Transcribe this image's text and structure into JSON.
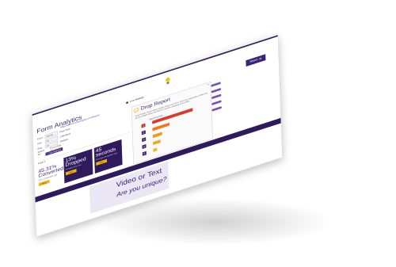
{
  "app": {
    "page_title": "Form Analytics",
    "url_text": "http://www.formanalytics.com/report",
    "hint_text": "Live Settings",
    "share_label": "Share"
  },
  "filters": {
    "rows": [
      {
        "label": "Form",
        "select": "Sign up",
        "value": "Free Trial"
      },
      {
        "label": "URL",
        "select": "All",
        "value": "Checkout"
      },
      {
        "label": "Seg",
        "select": "All",
        "value": "Visitors"
      }
    ],
    "add_segment_label": "+ Add Segment",
    "date_labels": {
      "from": "Select",
      "to": "From date"
    },
    "date_values": {
      "from": "All",
      "to": "26 - 4 - 15"
    }
  },
  "form_label": "Form 1",
  "kpis": {
    "conversion": {
      "value": "45.31%",
      "label": "Converted",
      "sub": "Form conversion rate",
      "button": "View"
    },
    "dropped": {
      "value": "13%",
      "label": "Dropped",
      "sub": "Average drop rate",
      "button": "View"
    },
    "time": {
      "value": "45",
      "label": "seconds",
      "sub": "Average completion time",
      "button": "View"
    }
  },
  "video_panel": {
    "title": "Video or Text",
    "subtitle": "Are you unique?"
  },
  "drop_report": {
    "title": "Drop Report",
    "close": "×",
    "description": "Drop Report shows where visitors leave your form. Each row represents a field and the bar length shows the share of visitors dropping at that field.",
    "chart_title": "Field Drop Rate"
  },
  "chart_data": {
    "type": "bar",
    "orientation": "horizontal",
    "categories": [
      "1",
      "2",
      "3",
      "4",
      "5"
    ],
    "values": [
      43,
      18,
      10,
      8,
      4
    ],
    "colors": [
      "#d93a2b",
      "#f07a1a",
      "#f09a1a",
      "#f0a81a",
      "#f0b81a"
    ],
    "xlim": [
      0,
      50
    ],
    "title": "Field Drop Rate"
  },
  "colors": {
    "brand": "#3c2475",
    "dark_band": "#2e1a5c",
    "accent": "#f2b300",
    "pill": "#7b4fb8"
  }
}
